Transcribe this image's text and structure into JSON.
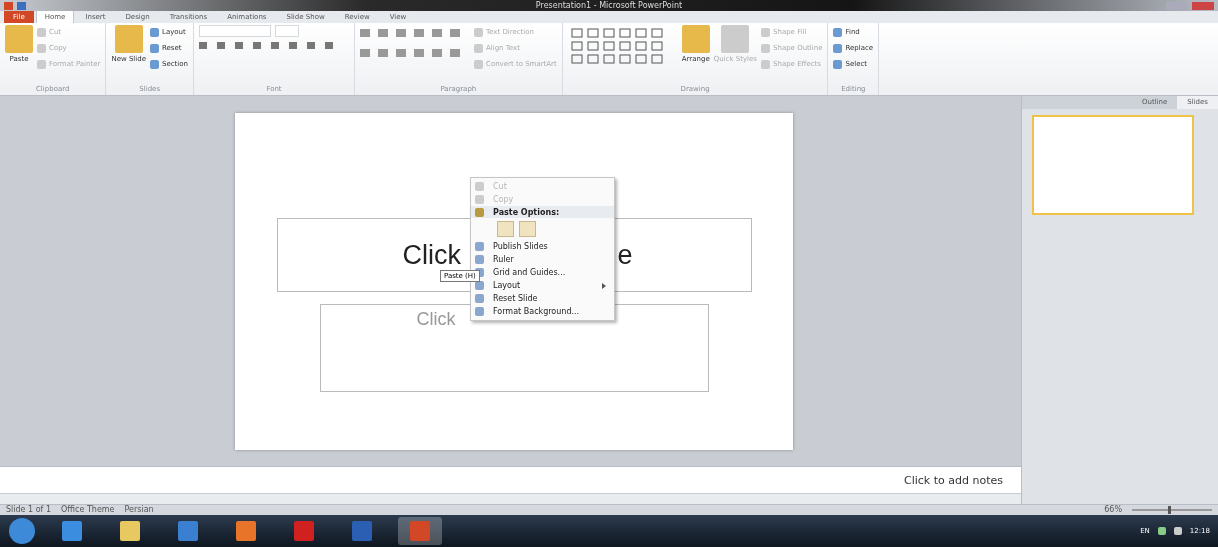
{
  "window": {
    "title": "Presentation1 - Microsoft PowerPoint"
  },
  "tabs": [
    {
      "label": "File",
      "kind": "file",
      "selected": false
    },
    {
      "label": "Home",
      "kind": "tab",
      "selected": true
    },
    {
      "label": "Insert",
      "kind": "tab",
      "selected": false
    },
    {
      "label": "Design",
      "kind": "tab",
      "selected": false
    },
    {
      "label": "Transitions",
      "kind": "tab",
      "selected": false
    },
    {
      "label": "Animations",
      "kind": "tab",
      "selected": false
    },
    {
      "label": "Slide Show",
      "kind": "tab",
      "selected": false
    },
    {
      "label": "Review",
      "kind": "tab",
      "selected": false
    },
    {
      "label": "View",
      "kind": "tab",
      "selected": false
    }
  ],
  "ribbon": [
    {
      "name": "Clipboard",
      "items": [
        {
          "label": "Paste",
          "kind": "large",
          "disabled": false
        },
        {
          "label": "Cut",
          "kind": "small",
          "disabled": true
        },
        {
          "label": "Copy",
          "kind": "small",
          "disabled": true
        },
        {
          "label": "Format Painter",
          "kind": "small",
          "disabled": true
        }
      ]
    },
    {
      "name": "Slides",
      "items": [
        {
          "label": "New Slide",
          "kind": "large",
          "disabled": false
        },
        {
          "label": "Layout",
          "kind": "small",
          "disabled": false
        },
        {
          "label": "Reset",
          "kind": "small",
          "disabled": false
        },
        {
          "label": "Section",
          "kind": "small",
          "disabled": false
        }
      ]
    },
    {
      "name": "Font",
      "items": [
        {
          "kind": "font-controls"
        }
      ]
    },
    {
      "name": "Paragraph",
      "items": [
        {
          "kind": "paragraph-controls"
        },
        {
          "label": "Text Direction",
          "kind": "small",
          "disabled": true
        },
        {
          "label": "Align Text",
          "kind": "small",
          "disabled": true
        },
        {
          "label": "Convert to SmartArt",
          "kind": "small",
          "disabled": true
        }
      ]
    },
    {
      "name": "Drawing",
      "items": [
        {
          "kind": "shapes-gallery"
        },
        {
          "label": "Arrange",
          "kind": "large",
          "disabled": false
        },
        {
          "label": "Quick Styles",
          "kind": "large",
          "disabled": true
        },
        {
          "label": "Shape Fill",
          "kind": "small",
          "disabled": true
        },
        {
          "label": "Shape Outline",
          "kind": "small",
          "disabled": true
        },
        {
          "label": "Shape Effects",
          "kind": "small",
          "disabled": true
        }
      ]
    },
    {
      "name": "Editing",
      "items": [
        {
          "label": "Find",
          "kind": "small",
          "disabled": false
        },
        {
          "label": "Replace",
          "kind": "small",
          "disabled": false
        },
        {
          "label": "Select",
          "kind": "small",
          "disabled": false
        }
      ]
    }
  ],
  "slide": {
    "title_placeholder": "Click",
    "title_tail": "e",
    "subtitle_placeholder": "Click"
  },
  "context_menu": [
    {
      "label": "Cut",
      "kind": "item",
      "disabled": true
    },
    {
      "label": "Copy",
      "kind": "item",
      "disabled": true
    },
    {
      "label": "Paste Options:",
      "kind": "header",
      "disabled": false
    },
    {
      "kind": "paste-icons"
    },
    {
      "label": "Publish Slides",
      "kind": "item",
      "disabled": false
    },
    {
      "label": "Ruler",
      "kind": "item",
      "disabled": false
    },
    {
      "label": "Grid and Guides...",
      "kind": "item",
      "disabled": false
    },
    {
      "label": "Layout",
      "kind": "item",
      "disabled": false,
      "submenu": true
    },
    {
      "label": "Reset Slide",
      "kind": "item",
      "disabled": false
    },
    {
      "label": "Format Background...",
      "kind": "item",
      "disabled": false
    }
  ],
  "tooltip": "Paste (H)",
  "side_tabs": [
    {
      "label": "Outline",
      "selected": false
    },
    {
      "label": "Slides",
      "selected": true
    }
  ],
  "notes": {
    "placeholder": "Click to add notes"
  },
  "status_bar": [
    "Slide 1 of 1",
    "Office Theme",
    "Persian"
  ],
  "zoom": {
    "reading": "66%",
    "level": 0.45
  },
  "taskbar": [
    {
      "kind": "ie",
      "selected": false
    },
    {
      "kind": "folder",
      "selected": false
    },
    {
      "kind": "media",
      "selected": false
    },
    {
      "kind": "firefox",
      "selected": false
    },
    {
      "kind": "pdf",
      "selected": false
    },
    {
      "kind": "word",
      "selected": false
    },
    {
      "kind": "powerpoint",
      "selected": true
    }
  ],
  "tray": {
    "language": "EN",
    "time": "12:18"
  }
}
